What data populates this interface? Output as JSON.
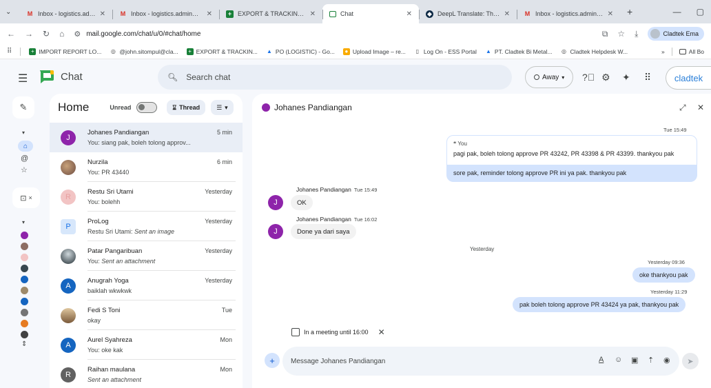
{
  "browser": {
    "tabs": [
      {
        "title": "Inbox - logistics.admin@cl",
        "icon": "gmail-icon",
        "active": false
      },
      {
        "title": "Inbox - logistics.admin@cl",
        "icon": "gmail-icon",
        "active": false
      },
      {
        "title": "EXPORT & TRACKING REF",
        "icon": "sheets-icon",
        "active": false
      },
      {
        "title": "Chat",
        "icon": "chat-icon",
        "active": true
      },
      {
        "title": "DeepL Translate: The world",
        "icon": "deepl-icon",
        "active": false
      },
      {
        "title": "Inbox - logistics.admin@cl",
        "icon": "gmail-icon",
        "active": false
      }
    ],
    "url": "mail.google.com/chat/u/0/#chat/home",
    "profile_label": "Cladtek Ema",
    "bookmarks": [
      {
        "label": "IMPORT REPORT LO..."
      },
      {
        "label": "@john.sitompul@cla..."
      },
      {
        "label": "EXPORT & TRACKIN..."
      },
      {
        "label": "PO (LOGISTIC) - Go..."
      },
      {
        "label": "Upload Image – re..."
      },
      {
        "label": "Log On - ESS Portal"
      },
      {
        "label": "PT. Cladtek Bi Metal..."
      },
      {
        "label": "Cladtek Helpdesk W..."
      }
    ],
    "all_bookmarks_label": "All Bo"
  },
  "header": {
    "app_name": "Chat",
    "search_placeholder": "Search chat",
    "status_label": "Away",
    "brand": "cladtek"
  },
  "list": {
    "title": "Home",
    "unread_label": "Unread",
    "thread_label": "Thread",
    "conversations": [
      {
        "name": "Johanes Pandiangan",
        "time": "5 min",
        "preview": "You: siang pak, boleh tolong approv...",
        "initial": "J",
        "avatar_color": "#8e24aa",
        "selected": true
      },
      {
        "name": "Nurzila",
        "time": "6 min",
        "preview": "You: PR 43440",
        "initial": "",
        "avatar_color": "#8d6e63",
        "selected": false
      },
      {
        "name": "Restu Sri Utami",
        "time": "Yesterday",
        "preview": "You: bolehh",
        "initial": "R",
        "avatar_color": "#f2c4c4",
        "selected": false
      },
      {
        "name": "ProLog",
        "time": "Yesterday",
        "preview_prefix": "Restu Sri Utami: ",
        "preview": "Sent an image",
        "initial": "P",
        "avatar_color": "#d7e7fb",
        "selected": false
      },
      {
        "name": "Patar Pangaribuan",
        "time": "Yesterday",
        "preview_prefix": "You: ",
        "preview": "Sent an attachment",
        "initial": "",
        "avatar_color": "#37474f",
        "selected": false
      },
      {
        "name": "Anugrah Yoga",
        "time": "Yesterday",
        "preview": "baiklah wkwkwk",
        "initial": "A",
        "avatar_color": "#1565c0",
        "selected": false
      },
      {
        "name": "Fedi S Toni",
        "time": "Tue",
        "preview": "okay",
        "initial": "",
        "avatar_color": "#b08a5a",
        "selected": false
      },
      {
        "name": "Aurel Syahreza",
        "time": "Mon",
        "preview": "You: oke kak",
        "initial": "A",
        "avatar_color": "#1565c0",
        "selected": false
      },
      {
        "name": "Raihan maulana",
        "time": "Mon",
        "preview": "Sent an attachment",
        "initial": "R",
        "avatar_color": "#616161",
        "selected": false
      }
    ]
  },
  "conversation": {
    "name": "Johanes Pandiangan",
    "messages": {
      "me_time_1": "Tue 15:49",
      "quote_label": "You",
      "quote_text": "pagi pak, boleh tolong approve PR 43242, PR 43398 & PR 43399. thankyou pak",
      "me_text_1": "sore pak, reminder tolong approve PR ini ya pak. thankyou pak",
      "them_1_sender": "Johanes Pandiangan",
      "them_1_time": "Tue 15:49",
      "them_1_text": "OK",
      "them_2_sender": "Johanes Pandiangan",
      "them_2_time": "Tue 16:02",
      "them_2_text": "Done ya dari saya",
      "day_separator": "Yesterday",
      "me_time_2": "Yesterday 09:36",
      "me_text_2": "oke thankyou pak",
      "me_time_3": "Yesterday 11:29",
      "me_text_3": "pak boleh tolong approve PR 43424 ya pak, thankyou pak"
    },
    "meeting_status": "In a meeting until 16:00",
    "composer_placeholder": "Message Johanes Pandiangan"
  },
  "colors": {
    "accent": "#0b57d0",
    "my_bubble": "#d3e3fd",
    "avatar_purple": "#8e24aa",
    "page_bg": "#f6f8fc"
  }
}
